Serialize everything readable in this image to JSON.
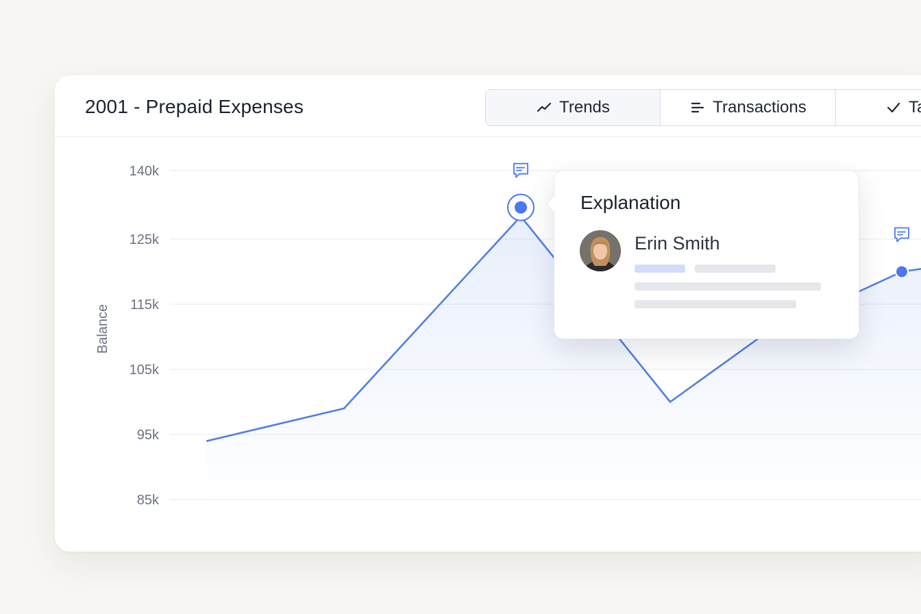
{
  "card": {
    "title": "2001 - Prepaid Expenses"
  },
  "tabs": [
    {
      "label": "Trends",
      "icon": "trend-line-icon",
      "active": true
    },
    {
      "label": "Transactions",
      "icon": "list-lines-icon",
      "active": false
    },
    {
      "label": "Ta",
      "icon": "checkmark-icon",
      "active": false
    }
  ],
  "popover": {
    "title": "Explanation",
    "author": "Erin Smith"
  },
  "colors": {
    "line": "#4f7fe3",
    "grid": "#eceef2",
    "accent_point": "#4a78f0",
    "axis_text": "#6b7280"
  },
  "chart_data": {
    "type": "area",
    "ylabel": "Balance",
    "xlabel": "",
    "yticks": [
      "140k",
      "125k",
      "115k",
      "105k",
      "95k",
      "85k"
    ],
    "series": [
      {
        "values": [
          94,
          99,
          130,
          100,
          110,
          120,
          121
        ]
      }
    ],
    "annotated_points": [
      2,
      5
    ]
  }
}
